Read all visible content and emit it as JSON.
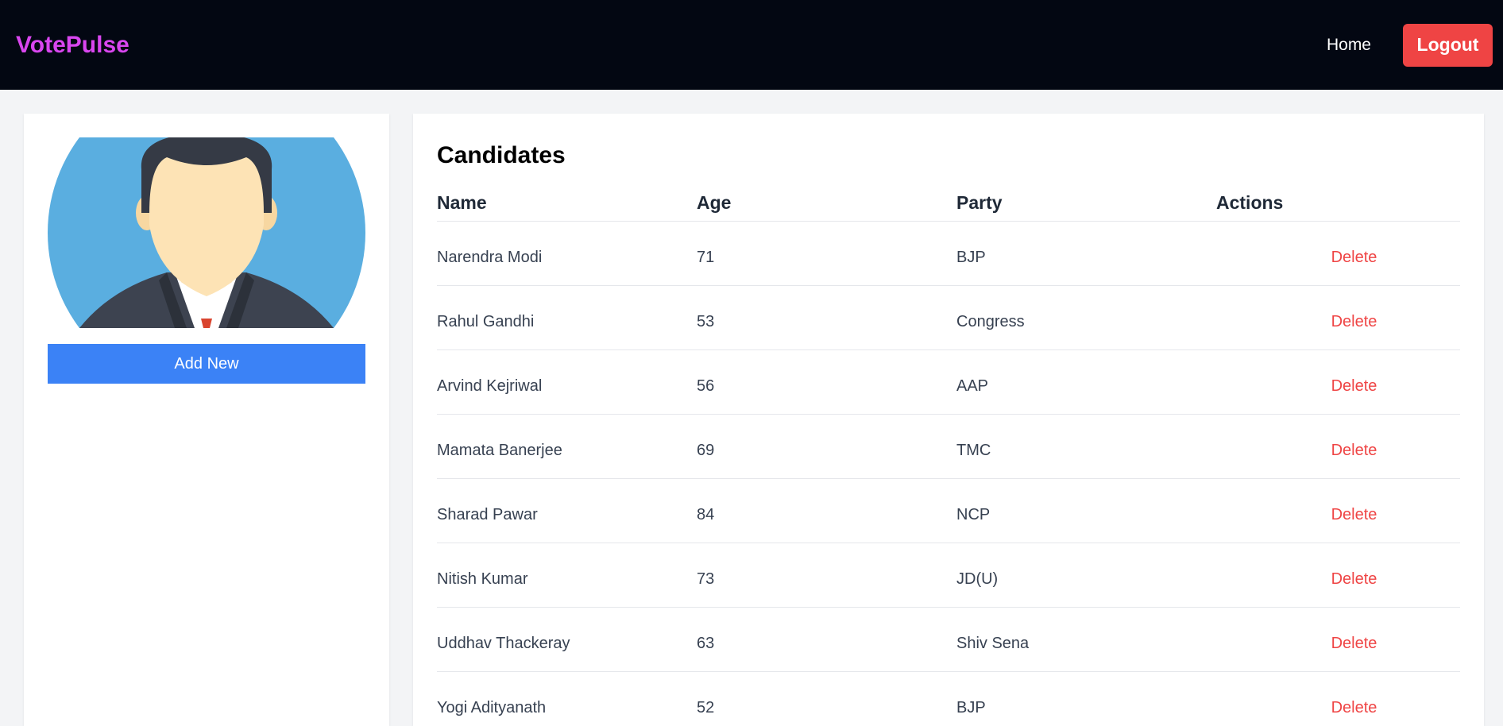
{
  "navbar": {
    "brand": "VotePulse",
    "home_label": "Home",
    "logout_label": "Logout"
  },
  "sidebar": {
    "add_label": "Add New"
  },
  "candidates": {
    "title": "Candidates",
    "columns": [
      "Name",
      "Age",
      "Party",
      "Actions"
    ],
    "rows": [
      {
        "name": "Narendra Modi",
        "age": "71",
        "party": "BJP",
        "action": "Delete"
      },
      {
        "name": "Rahul Gandhi",
        "age": "53",
        "party": "Congress",
        "action": "Delete"
      },
      {
        "name": "Arvind Kejriwal",
        "age": "56",
        "party": "AAP",
        "action": "Delete"
      },
      {
        "name": "Mamata Banerjee",
        "age": "69",
        "party": "TMC",
        "action": "Delete"
      },
      {
        "name": "Sharad Pawar",
        "age": "84",
        "party": "NCP",
        "action": "Delete"
      },
      {
        "name": "Nitish Kumar",
        "age": "73",
        "party": "JD(U)",
        "action": "Delete"
      },
      {
        "name": "Uddhav Thackeray",
        "age": "63",
        "party": "Shiv Sena",
        "action": "Delete"
      },
      {
        "name": "Yogi Adityanath",
        "age": "52",
        "party": "BJP",
        "action": "Delete"
      }
    ]
  },
  "colors": {
    "brand": "#d946ef",
    "navbar_bg": "#030712",
    "logout": "#ef4444",
    "primary": "#3b82f6",
    "delete": "#ef4444"
  },
  "icons": {
    "avatar": "person-avatar-icon"
  }
}
